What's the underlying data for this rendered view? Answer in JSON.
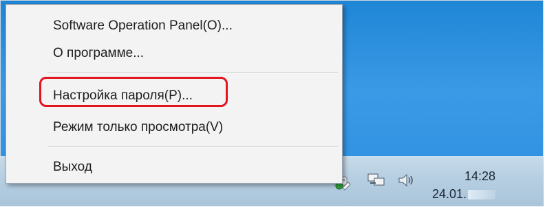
{
  "context_menu": {
    "items": [
      {
        "label": "Software Operation Panel(O)..."
      },
      {
        "label": "О программе..."
      },
      {
        "label": "Настройка пароля(P)..."
      },
      {
        "label": "Режим только просмотра(V)"
      },
      {
        "label": "Выход"
      }
    ],
    "highlighted_item": "Настройка пароля(P)...",
    "highlight_color": "#e3141c"
  },
  "taskbar": {
    "tray_icons": [
      "show-hidden-icons-chevron",
      "scanner-app-icon",
      "network-icon",
      "volume-icon"
    ],
    "clock": {
      "time": "14:28",
      "date": "24.01."
    }
  },
  "colors": {
    "desktop": "#2b8ee0",
    "menu_bg": "#f3f3f3",
    "taskbar": "#b7cfe2"
  }
}
